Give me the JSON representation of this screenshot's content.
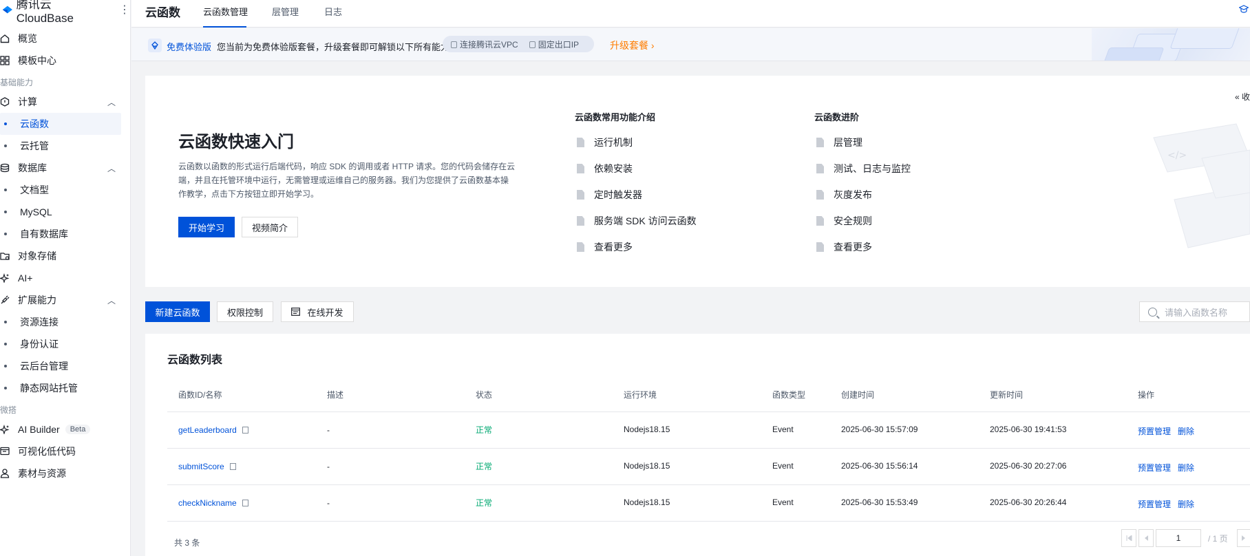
{
  "brand": {
    "name": "腾讯云 CloudBase",
    "menu": "⋮"
  },
  "sidebar": {
    "items": [
      {
        "label": "概览",
        "icon": "home-icon"
      },
      {
        "label": "模板中心",
        "icon": "grid-icon"
      }
    ],
    "groups": [
      {
        "label": "基础能力"
      },
      {
        "label": "微搭"
      }
    ],
    "sections": {
      "compute": {
        "label": "计算",
        "icon": "compute-icon",
        "subs": [
          "云函数",
          "云托管"
        ]
      },
      "database": {
        "label": "数据库",
        "icon": "database-icon",
        "subs": [
          "文档型",
          "MySQL",
          "自有数据库"
        ]
      },
      "storage": {
        "label": "对象存储",
        "icon": "folder-icon"
      },
      "ai": {
        "label": "AI+",
        "icon": "sparkle-icon"
      },
      "extension": {
        "label": "扩展能力",
        "icon": "plug-icon",
        "subs": [
          "资源连接",
          "身份认证",
          "云后台管理",
          "静态网站托管"
        ]
      },
      "aibuilder": {
        "label": "AI Builder",
        "badge": "Beta",
        "icon": "sparkle-icon"
      },
      "lowcode": {
        "label": "可视化低代码",
        "icon": "lowcode-icon"
      },
      "assets": {
        "label": "素材与资源",
        "icon": "assets-icon"
      }
    }
  },
  "header": {
    "title": "云函数",
    "tabs": [
      {
        "label": "云函数管理",
        "active": true
      },
      {
        "label": "层管理",
        "active": false
      },
      {
        "label": "日志",
        "active": false
      }
    ]
  },
  "banner": {
    "plan": "免费体验版",
    "description": "您当前为免费体验版套餐，升级套餐即可解锁以下所有能力",
    "features": [
      "连接腾讯云VPC",
      "固定出口IP"
    ],
    "upgrade": "升级套餐 ›"
  },
  "quickstart": {
    "title": "云函数快速入门",
    "intro": "云函数以函数的形式运行后端代码，响应 SDK 的调用或者 HTTP 请求。您的代码会储存在云端，并且在托管环境中运行，无需管理或运维自己的服务器。我们为您提供了云函数基本操作教学，点击下方按钮立即开始学习。",
    "start_button": "开始学习",
    "video_button": "视频简介",
    "collapse": "« 收",
    "columns": [
      {
        "title": "云函数常用功能介绍",
        "links": [
          "运行机制",
          "依赖安装",
          "定时触发器",
          "服务端 SDK 访问云函数",
          "查看更多"
        ]
      },
      {
        "title": "云函数进阶",
        "links": [
          "层管理",
          "测试、日志与监控",
          "灰度发布",
          "安全规则",
          "查看更多"
        ]
      }
    ]
  },
  "toolbar": {
    "new_button": "新建云函数",
    "permission_button": "权限控制",
    "online_dev_button": "在线开发",
    "search_placeholder": "请输入函数名称"
  },
  "table": {
    "title": "云函数列表",
    "columns": [
      "函数ID/名称",
      "描述",
      "状态",
      "运行环境",
      "函数类型",
      "创建时间",
      "更新时间",
      "操作"
    ],
    "rows": [
      {
        "name": "getLeaderboard",
        "desc": "-",
        "status": "正常",
        "runtime": "Nodejs18.15",
        "type": "Event",
        "created": "2025-06-30 15:57:09",
        "updated": "2025-06-30 19:41:53",
        "action1": "预置管理",
        "action2": "删除"
      },
      {
        "name": "submitScore",
        "desc": "-",
        "status": "正常",
        "runtime": "Nodejs18.15",
        "type": "Event",
        "created": "2025-06-30 15:56:14",
        "updated": "2025-06-30 20:27:06",
        "action1": "预置管理",
        "action2": "删除"
      },
      {
        "name": "checkNickname",
        "desc": "-",
        "status": "正常",
        "runtime": "Nodejs18.15",
        "type": "Event",
        "created": "2025-06-30 15:53:49",
        "updated": "2025-06-30 20:26:44",
        "action1": "预置管理",
        "action2": "删除"
      }
    ],
    "total": "共 3 条",
    "page_current": "1",
    "page_total": "/ 1 页"
  },
  "colors": {
    "primary": "#0052d9",
    "success": "#00a870",
    "warning": "#ff7d00"
  }
}
